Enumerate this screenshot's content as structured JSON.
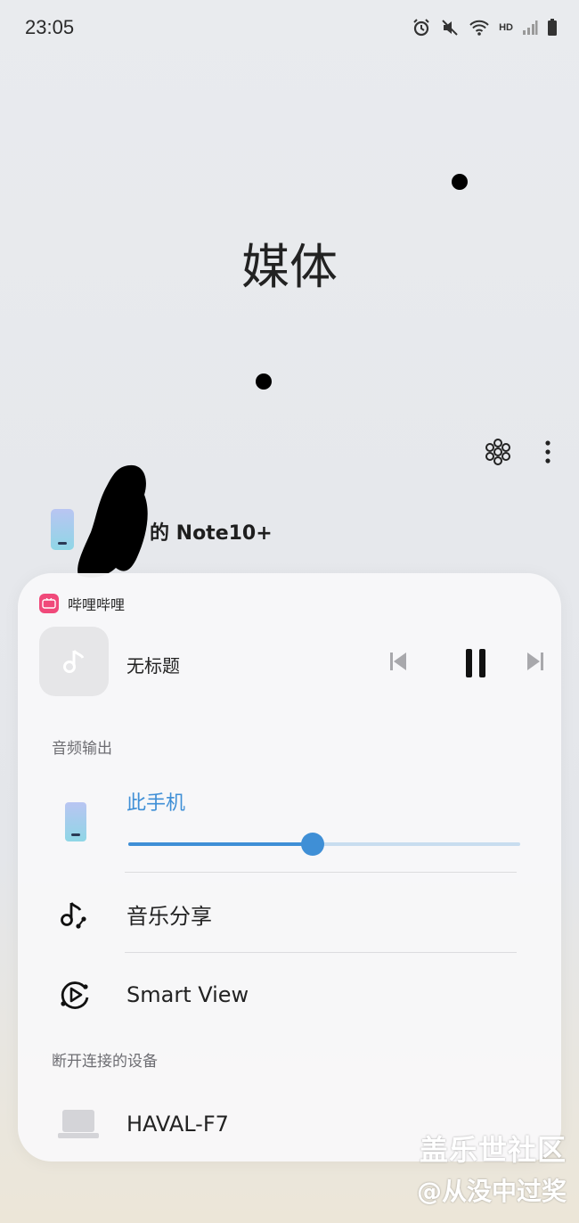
{
  "status_bar": {
    "time": "23:05",
    "icons": [
      "alarm-icon",
      "mute-icon",
      "wifi-icon",
      "hd-icon",
      "signal-icon",
      "battery-icon"
    ],
    "hd_label": "HD"
  },
  "page_title": "媒体",
  "top_actions": [
    "devices-icon",
    "more-icon"
  ],
  "device": {
    "name": "的 Note10+",
    "icon": "phone-icon"
  },
  "media_panel": {
    "app_name": "哔哩哔哩",
    "app_color": "#f0497a",
    "track_title": "无标题",
    "controls": [
      "previous-icon",
      "pause-icon",
      "next-icon"
    ]
  },
  "audio_output": {
    "section_label": "音频输出",
    "current_device": "此手机",
    "volume": 0.47,
    "accent": "#3f8fd6"
  },
  "options": [
    {
      "label": "音乐分享",
      "icon": "music-share-icon"
    },
    {
      "label": "Smart View",
      "icon": "smart-view-icon"
    }
  ],
  "disconnected": {
    "section_label": "断开连接的设备",
    "devices": [
      {
        "label": "HAVAL-F7",
        "icon": "laptop-icon"
      }
    ]
  },
  "watermark": {
    "line1": "盖乐世社区",
    "line2": "@从没中过奖"
  }
}
